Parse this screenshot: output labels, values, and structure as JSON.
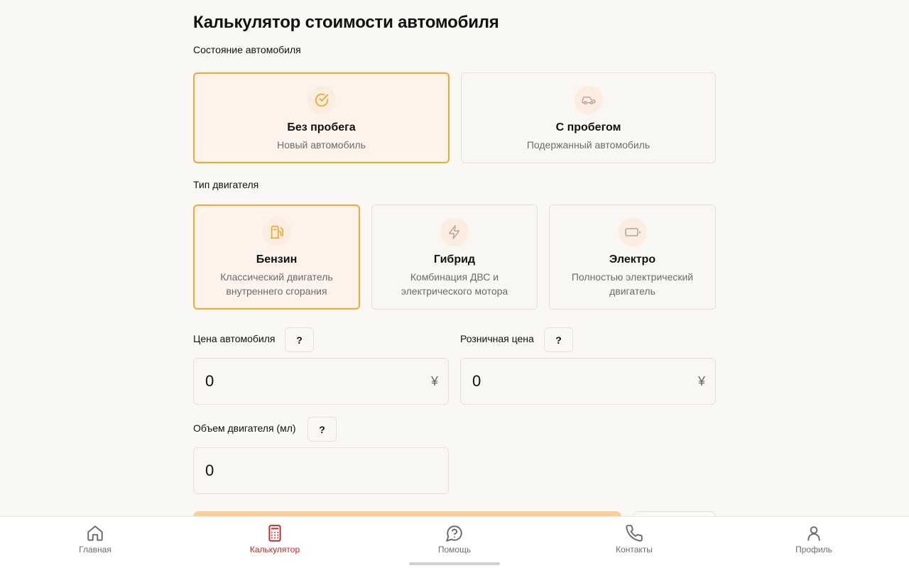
{
  "page": {
    "title": "Калькулятор стоимости автомобиля"
  },
  "condition": {
    "label": "Состояние автомобиля",
    "options": [
      {
        "title": "Без пробега",
        "subtitle": "Новый автомобиль",
        "icon": "check-circle-icon",
        "selected": true
      },
      {
        "title": "С пробегом",
        "subtitle": "Подержанный автомобиль",
        "icon": "car-icon",
        "selected": false
      }
    ]
  },
  "engine_type": {
    "label": "Тип двигателя",
    "options": [
      {
        "title": "Бензин",
        "subtitle": "Классический двигатель внутреннего сгорания",
        "icon": "fuel-pump-icon",
        "selected": true
      },
      {
        "title": "Гибрид",
        "subtitle": "Комбинация ДВС и электрического мотора",
        "icon": "lightning-icon",
        "selected": false
      },
      {
        "title": "Электро",
        "subtitle": "Полностью электрический двигатель",
        "icon": "battery-icon",
        "selected": false
      }
    ]
  },
  "fields": {
    "car_price": {
      "label": "Цена автомобиля",
      "help": "?",
      "value": "0",
      "currency": "¥"
    },
    "retail_price": {
      "label": "Розничная цена",
      "help": "?",
      "value": "0",
      "currency": "¥"
    },
    "engine_volume": {
      "label": "Объем двигателя (мл)",
      "help": "?",
      "value": "0"
    }
  },
  "nav": {
    "items": [
      {
        "label": "Главная",
        "icon": "home-icon",
        "active": false
      },
      {
        "label": "Калькулятор",
        "icon": "calculator-icon",
        "active": true
      },
      {
        "label": "Помощь",
        "icon": "help-chat-icon",
        "active": false
      },
      {
        "label": "Контакты",
        "icon": "phone-icon",
        "active": false
      },
      {
        "label": "Профиль",
        "icon": "user-icon",
        "active": false
      }
    ]
  },
  "colors": {
    "accent": "#f0a92e",
    "selected_bg": "#fdf3eb",
    "nav_active": "#d32222",
    "submit": "#f8cf95"
  }
}
